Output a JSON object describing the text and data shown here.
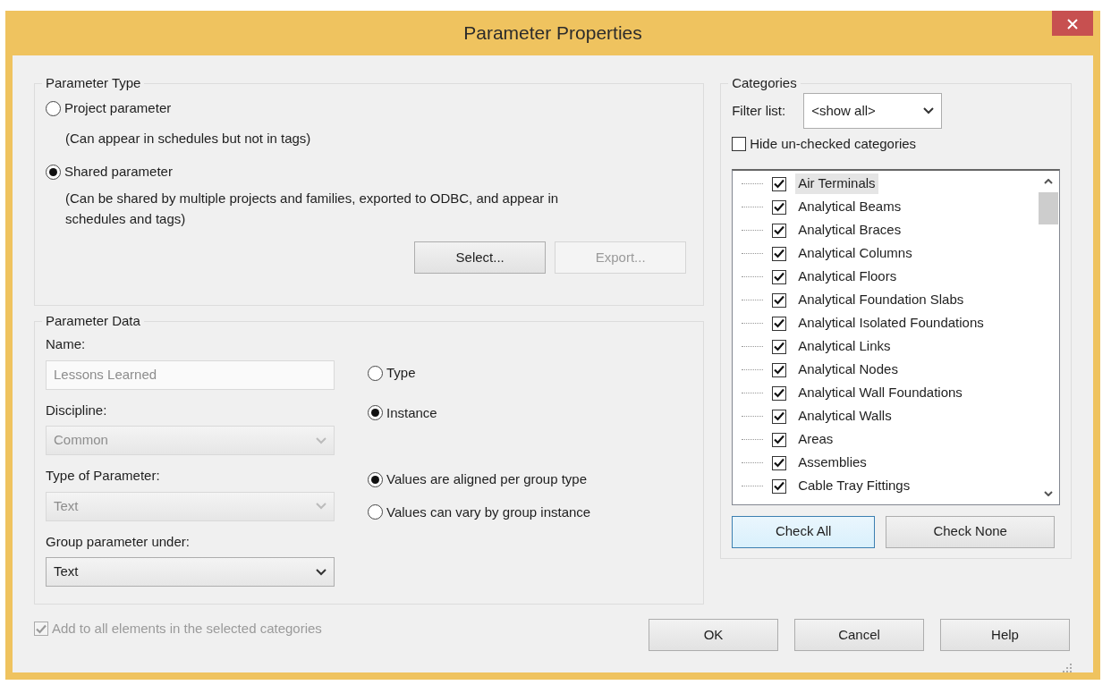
{
  "window": {
    "title": "Parameter Properties"
  },
  "parameter_type": {
    "title": "Parameter Type",
    "options": [
      {
        "label": "Project parameter",
        "note": "(Can appear in schedules but not in tags)",
        "selected": false
      },
      {
        "label": "Shared parameter",
        "note": "(Can be shared by multiple projects and families, exported to ODBC, and appear in schedules and tags)",
        "selected": true
      }
    ],
    "buttons": [
      {
        "label": "Select...",
        "disabled": false
      },
      {
        "label": "Export...",
        "disabled": true
      }
    ]
  },
  "parameter_data": {
    "title": "Parameter Data",
    "fields": [
      {
        "label": "Name:",
        "kind": "text",
        "value": "Lessons Learned",
        "disabled": true
      },
      {
        "label": "Discipline:",
        "kind": "select",
        "value": "Common",
        "disabled": true
      },
      {
        "label": "Type of Parameter:",
        "kind": "select",
        "value": "Text",
        "disabled": true
      },
      {
        "label": "Group parameter under:",
        "kind": "select",
        "value": "Text",
        "disabled": false
      }
    ],
    "instance_options": [
      {
        "label": "Type",
        "selected": false
      },
      {
        "label": "Instance",
        "selected": true
      }
    ],
    "group_options": [
      {
        "label": "Values are aligned per group type",
        "selected": true
      },
      {
        "label": "Values can vary by group instance",
        "selected": false
      }
    ]
  },
  "add_to_all": {
    "label": "Add to all elements in the selected categories",
    "checked": true,
    "disabled": true
  },
  "categories": {
    "title": "Categories",
    "filter_label": "Filter list:",
    "filter_value": "<show all>",
    "hide_unchecked": {
      "label": "Hide un-checked categories",
      "checked": false
    },
    "items": [
      {
        "label": "Air Terminals",
        "checked": true,
        "selected": true
      },
      {
        "label": "Analytical Beams",
        "checked": true,
        "selected": false
      },
      {
        "label": "Analytical Braces",
        "checked": true,
        "selected": false
      },
      {
        "label": "Analytical Columns",
        "checked": true,
        "selected": false
      },
      {
        "label": "Analytical Floors",
        "checked": true,
        "selected": false
      },
      {
        "label": "Analytical Foundation Slabs",
        "checked": true,
        "selected": false
      },
      {
        "label": "Analytical Isolated Foundations",
        "checked": true,
        "selected": false
      },
      {
        "label": "Analytical Links",
        "checked": true,
        "selected": false
      },
      {
        "label": "Analytical Nodes",
        "checked": true,
        "selected": false
      },
      {
        "label": "Analytical Wall Foundations",
        "checked": true,
        "selected": false
      },
      {
        "label": "Analytical Walls",
        "checked": true,
        "selected": false
      },
      {
        "label": "Areas",
        "checked": true,
        "selected": false
      },
      {
        "label": "Assemblies",
        "checked": true,
        "selected": false
      },
      {
        "label": "Cable Tray Fittings",
        "checked": true,
        "selected": false
      }
    ],
    "buttons": [
      {
        "label": "Check All",
        "focused": true
      },
      {
        "label": "Check None",
        "focused": false
      }
    ]
  },
  "buttons": [
    "OK",
    "Cancel",
    "Help"
  ]
}
